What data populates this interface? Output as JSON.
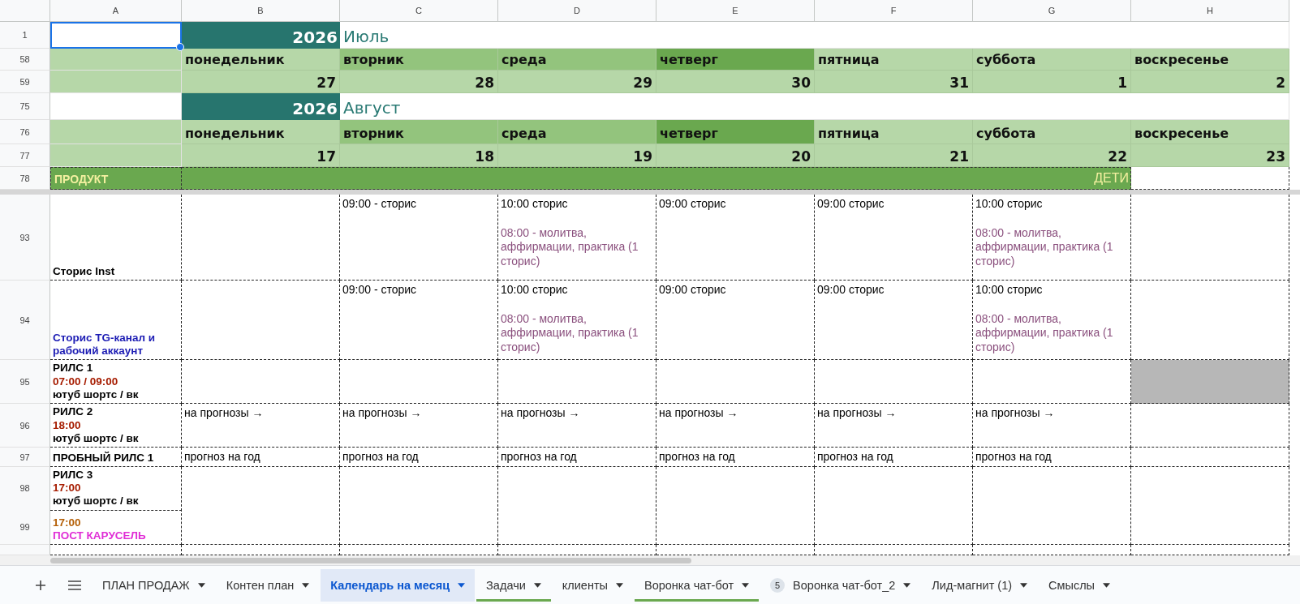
{
  "columns": [
    "A",
    "B",
    "C",
    "D",
    "E",
    "F",
    "G",
    "H"
  ],
  "months": [
    {
      "title_row": "1",
      "year": "2026",
      "month": "Июль",
      "a_selected": true,
      "weekday_row": "58",
      "date_row": "59",
      "weekdays": [
        {
          "label": "понедельник",
          "color": "#b6d7a8"
        },
        {
          "label": "вторник",
          "color": "#93c47d"
        },
        {
          "label": "среда",
          "color": "#93c47d"
        },
        {
          "label": "четверг",
          "color": "#6aa84f"
        },
        {
          "label": "пятница",
          "color": "#b6d7a8"
        },
        {
          "label": "суббота",
          "color": "#b6d7a8"
        },
        {
          "label": "воскресенье",
          "color": "#b6d7a8"
        }
      ],
      "dates": [
        "27",
        "28",
        "29",
        "30",
        "31",
        "1",
        "2"
      ]
    },
    {
      "title_row": "75",
      "year": "2026",
      "month": "Август",
      "a_selected": false,
      "weekday_row": "76",
      "date_row": "77",
      "weekdays": [
        {
          "label": "понедельник",
          "color": "#b6d7a8"
        },
        {
          "label": "вторник",
          "color": "#93c47d"
        },
        {
          "label": "среда",
          "color": "#93c47d"
        },
        {
          "label": "четверг",
          "color": "#6aa84f"
        },
        {
          "label": "пятница",
          "color": "#b6d7a8"
        },
        {
          "label": "суббота",
          "color": "#b6d7a8"
        },
        {
          "label": "воскресенье",
          "color": "#b6d7a8"
        }
      ],
      "dates": [
        "17",
        "18",
        "19",
        "20",
        "21",
        "22",
        "23"
      ]
    }
  ],
  "product_row": {
    "row": "78",
    "label": "ПРОДУКТ",
    "section": "ДЕТИ"
  },
  "rows": [
    {
      "row": "93",
      "label": [
        {
          "text": "Сторис Inst",
          "color": "#000000"
        }
      ],
      "cells": [
        {},
        {
          "lines": [
            {
              "text": "09:00 - сторис",
              "color": "#000000"
            }
          ]
        },
        {
          "lines": [
            {
              "text": "10:00 сторис",
              "color": "#000000"
            },
            {
              "text": "08:00 - молитва, аффирмации, практика (1 сторис)",
              "color": "#8a4f7d"
            }
          ]
        },
        {
          "lines": [
            {
              "text": "09:00 сторис",
              "color": "#000000"
            }
          ]
        },
        {
          "lines": [
            {
              "text": "09:00 сторис",
              "color": "#000000"
            }
          ]
        },
        {
          "lines": [
            {
              "text": "10:00 сторис",
              "color": "#000000"
            },
            {
              "text": "08:00 - молитва, аффирмации, практика (1 сторис)",
              "color": "#8a4f7d"
            }
          ]
        },
        {}
      ]
    },
    {
      "row": "94",
      "label": [
        {
          "text": "Сторис TG-канал и рабочий аккаунт",
          "color": "#1c1cb4"
        }
      ],
      "cells": [
        {},
        {
          "lines": [
            {
              "text": "09:00 - сторис",
              "color": "#000000"
            }
          ]
        },
        {
          "lines": [
            {
              "text": "10:00 сторис",
              "color": "#000000"
            },
            {
              "text": "08:00 - молитва, аффирмации, практика (1 сторис)",
              "color": "#8a4f7d"
            }
          ]
        },
        {
          "lines": [
            {
              "text": "09:00 сторис",
              "color": "#000000"
            }
          ]
        },
        {
          "lines": [
            {
              "text": "09:00 сторис",
              "color": "#000000"
            }
          ]
        },
        {
          "lines": [
            {
              "text": "10:00 сторис",
              "color": "#000000"
            },
            {
              "text": "08:00 - молитва, аффирмации, практика (1 сторис)",
              "color": "#8a4f7d"
            }
          ]
        },
        {}
      ]
    },
    {
      "row": "95",
      "label": [
        {
          "text": "РИЛС 1",
          "color": "#000000"
        },
        {
          "text": "07:00 / 09:00",
          "color": "#a61c00"
        },
        {
          "text": "ютуб шортс / вк",
          "color": "#000000"
        }
      ],
      "cells": [
        {},
        {},
        {},
        {},
        {},
        {},
        {
          "color": "#b7b7b7"
        }
      ]
    },
    {
      "row": "96",
      "label": [
        {
          "text": "РИЛС 2",
          "color": "#000000"
        },
        {
          "text": "18:00",
          "color": "#a61c00"
        },
        {
          "text": "ютуб шортс / вк",
          "color": "#000000"
        }
      ],
      "cells": [
        {
          "lines": [
            {
              "text": "на прогнозы →",
              "color": "#000000"
            }
          ]
        },
        {
          "lines": [
            {
              "text": "на прогнозы →",
              "color": "#000000"
            }
          ]
        },
        {
          "lines": [
            {
              "text": "на прогнозы →",
              "color": "#000000"
            }
          ]
        },
        {
          "lines": [
            {
              "text": "на прогнозы →",
              "color": "#000000"
            }
          ]
        },
        {
          "lines": [
            {
              "text": "на прогнозы →",
              "color": "#000000"
            }
          ]
        },
        {
          "lines": [
            {
              "text": "на прогнозы →",
              "color": "#000000"
            }
          ]
        },
        {}
      ]
    },
    {
      "row": "97",
      "label": [
        {
          "text": "ПРОБНЫЙ РИЛС 1",
          "color": "#000000"
        }
      ],
      "cells": [
        {
          "lines": [
            {
              "text": "прогноз на год",
              "color": "#000000"
            }
          ]
        },
        {
          "lines": [
            {
              "text": "прогноз на год",
              "color": "#000000"
            }
          ]
        },
        {
          "lines": [
            {
              "text": "прогноз на год",
              "color": "#000000"
            }
          ]
        },
        {
          "lines": [
            {
              "text": "прогноз на год",
              "color": "#000000"
            }
          ]
        },
        {
          "lines": [
            {
              "text": "прогноз на год",
              "color": "#000000"
            }
          ]
        },
        {
          "lines": [
            {
              "text": "прогноз на год",
              "color": "#000000"
            }
          ]
        },
        {}
      ]
    },
    {
      "row": "98",
      "label": [
        {
          "text": "РИЛС 3",
          "color": "#000000"
        },
        {
          "text": "17:00",
          "color": "#a61c00"
        },
        {
          "text": "ютуб шортс  / вк",
          "color": "#000000"
        }
      ],
      "cells": [
        {},
        {},
        {},
        {},
        {},
        {},
        {}
      ]
    },
    {
      "row": "99",
      "label": [
        {
          "text": "17:00",
          "color": "#b45f06"
        },
        {
          "text": "ПОСТ КАРУСЕЛЬ",
          "color": "#e02ed6"
        }
      ],
      "cells": [
        {},
        {},
        {},
        {},
        {},
        {},
        {}
      ]
    }
  ],
  "sheet_tabs": [
    {
      "label": "ПЛАН ПРОДАЖ",
      "selected": false
    },
    {
      "label": "Контен план",
      "selected": false
    },
    {
      "label": "Календарь на месяц",
      "selected": true
    },
    {
      "label": "Задачи",
      "selected": false,
      "color": "#6aa84f"
    },
    {
      "label": "клиенты",
      "selected": false
    },
    {
      "label": "Воронка чат-бот",
      "selected": false,
      "color": "#6aa84f"
    },
    {
      "label": "Воронка чат-бот_2",
      "selected": false,
      "badge": "5"
    },
    {
      "label": "Лид-магнит (1)",
      "selected": false
    },
    {
      "label": "Смыслы",
      "selected": false
    }
  ]
}
